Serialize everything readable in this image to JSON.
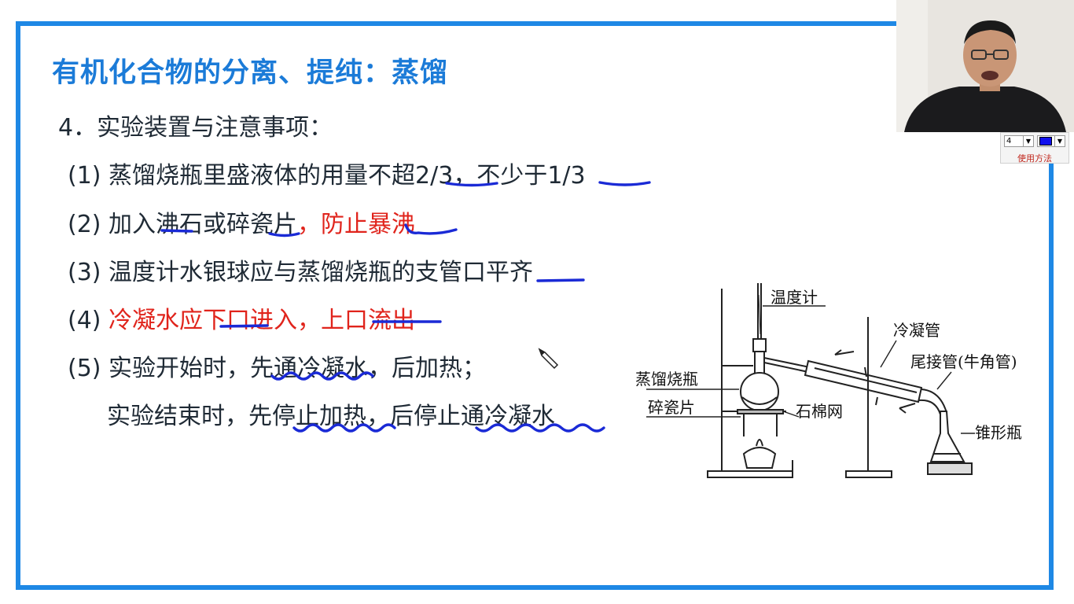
{
  "slide": {
    "title": "有机化合物的分离、提纯：蒸馏",
    "section_heading": "4．实验装置与注意事项：",
    "items": [
      {
        "num": "(1) ",
        "parts": [
          "蒸馏烧瓶里盛液体的用量不超",
          "2/3",
          "，不少于",
          "1/3"
        ]
      },
      {
        "num": "(2) ",
        "parts": [
          "加入沸石或碎瓷片",
          "，",
          "防止暴沸"
        ]
      },
      {
        "num": "(3) ",
        "parts": [
          "温度计水银球应与蒸馏烧瓶的支管口",
          "平齐"
        ]
      },
      {
        "num": "(4) ",
        "parts": [
          "冷凝水应下口进入",
          "，",
          "上口流出"
        ]
      },
      {
        "num": "(5) ",
        "parts": [
          "实验开始时，",
          "先通冷凝水",
          "，后加热；"
        ]
      },
      {
        "num": "",
        "parts": [
          "实验结束时，",
          "先停止加热",
          "，",
          "后停止通冷凝水"
        ]
      }
    ]
  },
  "diagram": {
    "labels": {
      "thermometer": "温度计",
      "condenser": "冷凝管",
      "adapter": "尾接管(牛角管)",
      "flask": "蒸馏烧瓶",
      "porcelain": "碎瓷片",
      "gauze": "石棉网",
      "erlenmeyer": "锥形瓶"
    }
  },
  "pen_toolbar": {
    "pen_width": "4",
    "pen_color": "#1010ee",
    "usage_link": "使用方法"
  },
  "colors": {
    "frame_blue": "#1e88e5",
    "title_blue": "#1b7bd8",
    "red_text": "#e0241c",
    "annotation_ink": "#1a2ad6"
  },
  "icons": [
    "pencil-cursor-icon",
    "dropdown-arrow-icon"
  ]
}
